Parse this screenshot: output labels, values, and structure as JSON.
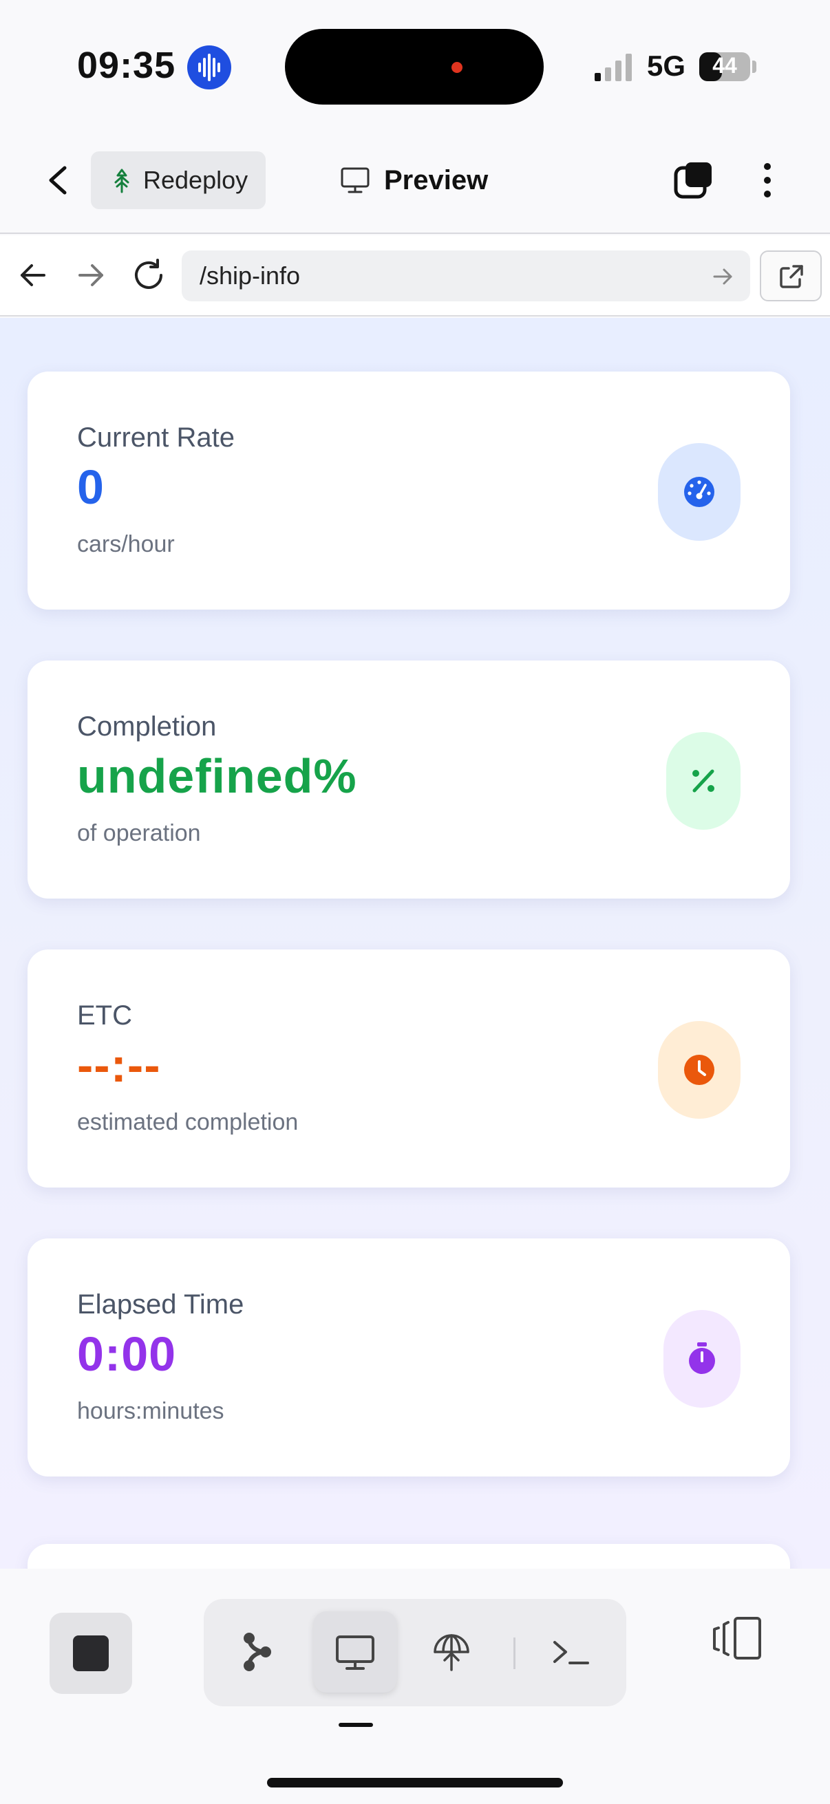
{
  "status_bar": {
    "time": "09:35",
    "network": "5G",
    "battery": "44",
    "battery_level": 0.44
  },
  "header": {
    "back_icon": "chevron-left-icon",
    "redeploy_label": "Redeploy",
    "redeploy_icon": "tree-icon",
    "title": "Preview",
    "title_icon": "monitor-icon",
    "tabs_icon": "tabs-icon",
    "more_icon": "more-vertical-icon"
  },
  "urlbar": {
    "url": "/ship-info"
  },
  "cards": [
    {
      "label": "Current Rate",
      "value": "0",
      "sub": "cars/hour",
      "icon": "speedometer-icon",
      "color": "#2563eb",
      "bg": "#dbe7fe"
    },
    {
      "label": "Completion",
      "value": "undefined%",
      "sub": "of operation",
      "icon": "percent-icon",
      "color": "#16a34a",
      "bg": "#dcfce7"
    },
    {
      "label": "ETC",
      "value": "--:--",
      "sub": "estimated completion",
      "icon": "clock-icon",
      "color": "#ea580c",
      "bg": "#ffedd5"
    },
    {
      "label": "Elapsed Time",
      "value": "0:00",
      "sub": "hours:minutes",
      "icon": "stopwatch-icon",
      "color": "#9333ea",
      "bg": "#f3e8ff"
    }
  ],
  "toolbar": {
    "stop_icon": "stop-icon",
    "tools": [
      "branch-icon",
      "monitor-icon",
      "deploy-icon",
      "terminal-icon"
    ],
    "active_tool": "monitor-icon",
    "panel_icon": "panel-toggle-icon"
  }
}
